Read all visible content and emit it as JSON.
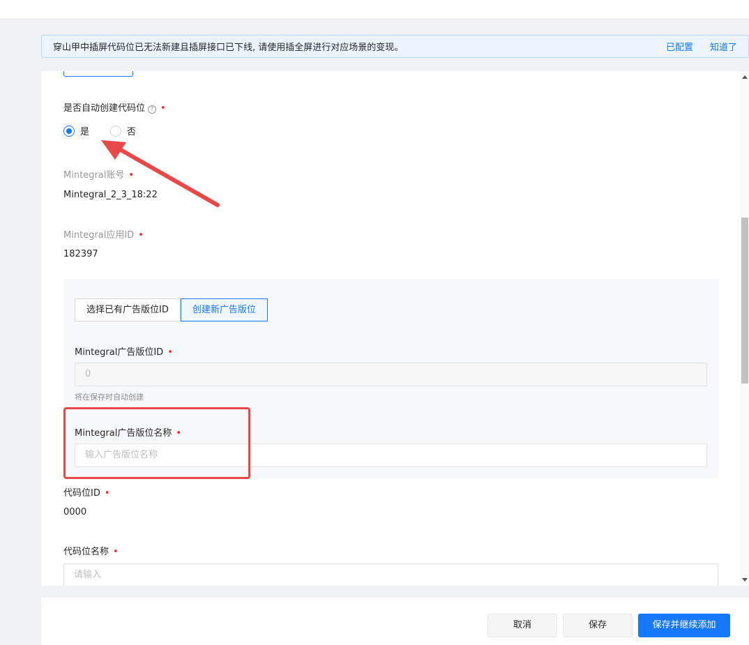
{
  "notice": {
    "message": "穿山甲中插屏代码位已无法新建且插屏接口已下线, 请使用插全屏进行对应场景的变现。",
    "link_configured": "已配置",
    "link_got_it": "知道了"
  },
  "form": {
    "auto_create_label": "是否自动创建代码位",
    "auto_create_options": [
      "是",
      "否"
    ],
    "auto_create_selected": "是",
    "account_label": "Mintegral账号",
    "account_value": "Mintegral_2_3_18:22",
    "app_id_label": "Mintegral应用ID",
    "app_id_value": "182397",
    "placement_tabs": [
      "选择已有广告版位ID",
      "创建新广告版位"
    ],
    "placement_tab_active": "创建新广告版位",
    "placement_id_label": "Mintegral广告版位ID",
    "placement_id_value": "0",
    "placement_id_hint": "将在保存时自动创建",
    "placement_name_label": "Mintegral广告版位名称",
    "placement_name_placeholder": "输入广告版位名称",
    "code_id_label": "代码位ID",
    "code_id_value": "0000",
    "code_name_label": "代码位名称",
    "code_name_placeholder": "请输入",
    "required_mark": "•",
    "help_icon_glyph": "?"
  },
  "footer": {
    "cancel_label": "取消",
    "save_label": "保存",
    "save_continue_label": "保存并继续添加"
  },
  "colors": {
    "accent": "#1677ff",
    "annotation": "#e84848"
  },
  "icons": [
    "help-circle-icon",
    "arrow-annotation-icon"
  ]
}
